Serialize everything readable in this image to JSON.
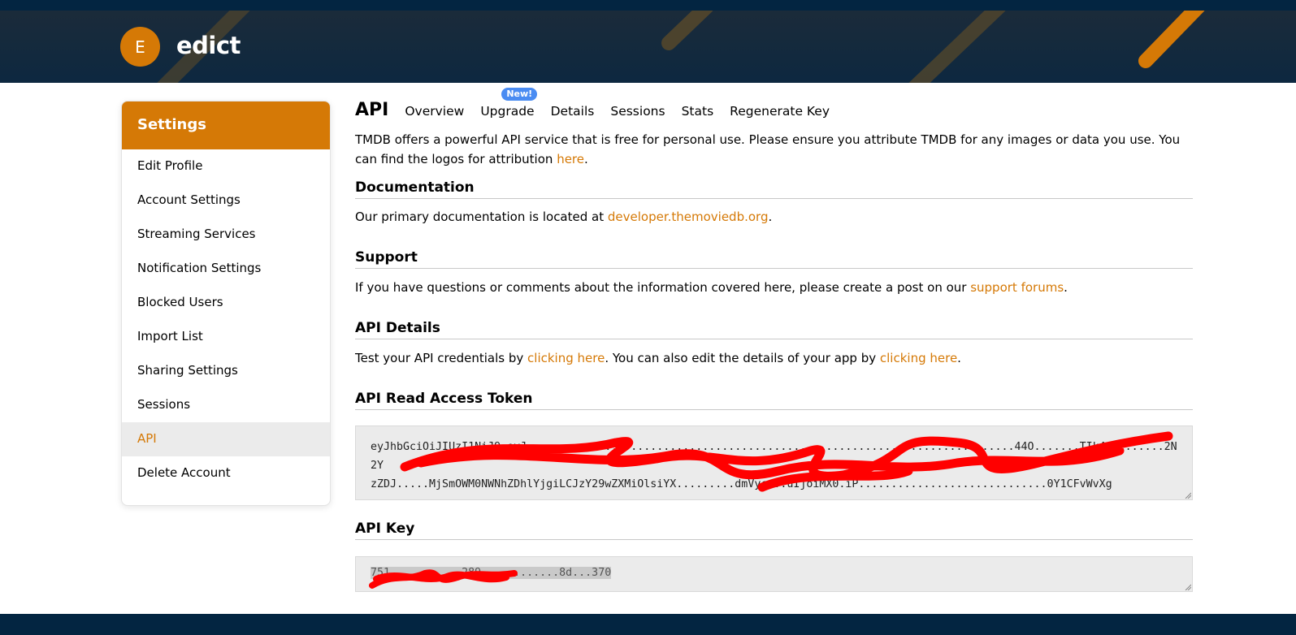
{
  "header": {
    "avatar_initial": "E",
    "username": "edict",
    "bg_color": "#032541",
    "accent_color": "#d57906"
  },
  "sidebar": {
    "title": "Settings",
    "items": [
      {
        "label": "Edit Profile"
      },
      {
        "label": "Account Settings"
      },
      {
        "label": "Streaming Services"
      },
      {
        "label": "Notification Settings"
      },
      {
        "label": "Blocked Users"
      },
      {
        "label": "Import List"
      },
      {
        "label": "Sharing Settings"
      },
      {
        "label": "Sessions"
      },
      {
        "label": "API"
      },
      {
        "label": "Delete Account"
      }
    ],
    "active_item": "API"
  },
  "tabs": {
    "title": "API",
    "items": [
      {
        "label": "Overview"
      },
      {
        "label": "Upgrade",
        "badge": "New!"
      },
      {
        "label": "Details"
      },
      {
        "label": "Sessions"
      },
      {
        "label": "Stats"
      },
      {
        "label": "Regenerate Key"
      }
    ]
  },
  "intro": {
    "text": "TMDB offers a powerful API service that is free for personal use. Please ensure you attribute TMDB for any images or data you use. You can find the logos for attribution ",
    "link": "here",
    "end": "."
  },
  "documentation": {
    "heading": "Documentation",
    "text": "Our primary documentation is located at ",
    "link": "developer.themoviedb.org",
    "end": "."
  },
  "support": {
    "heading": "Support",
    "text": "If you have questions or comments about the information covered here, please create a post on our ",
    "link": "support forums",
    "end": "."
  },
  "api_details": {
    "heading": "API Details",
    "text1": "Test your API credentials by ",
    "link1": "clicking here",
    "text2": ". You can also edit the details of your app by ",
    "link2": "clicking here",
    "end": "."
  },
  "read_token": {
    "heading": "API Read Access Token",
    "line1": "eyJhbGciOiJIUzI1NiJ9.eyJ...........................................................................44O.......TIk4.........2N2Y",
    "line2": "zZDJ.....MjSmOWM0NWNhZDhlYjgiLCJzY29wZXMiOlsiYX.........dmVyc...uIjoiMX0.iP.............................0Y1CFvWvXg"
  },
  "api_key": {
    "heading": "API Key",
    "value": "751...........289............8d...370"
  }
}
